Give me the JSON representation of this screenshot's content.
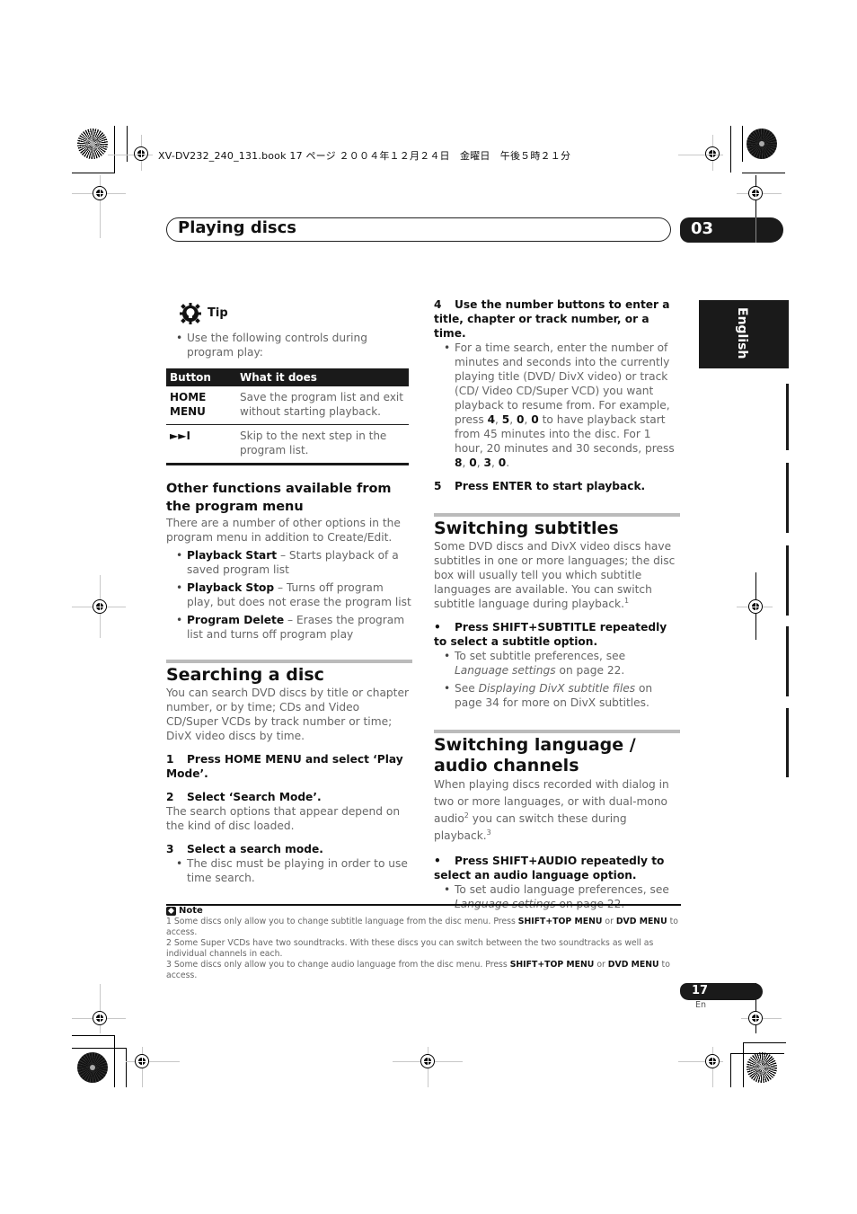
{
  "print_header": "XV-DV232_240_131.book  17 ページ  ２００４年１２月２４日　金曜日　午後５時２１分",
  "chapter": {
    "title": "Playing discs",
    "number": "03"
  },
  "language_tab": "English",
  "tip": {
    "label": "Tip",
    "intro": "Use the following controls during program play:",
    "table": {
      "headers": [
        "Button",
        "What it does"
      ],
      "rows": [
        {
          "button": "HOME MENU",
          "description": "Save the program list and exit without starting playback."
        },
        {
          "button": "►►I",
          "description": "Skip to the next step in the program list."
        }
      ]
    }
  },
  "other_functions": {
    "heading": "Other functions available from the program menu",
    "intro": "There are a number of other options in the program menu in addition to Create/Edit.",
    "items": [
      {
        "term": "Playback Start",
        "text": " – Starts playback of a saved program list"
      },
      {
        "term": "Playback Stop",
        "text": " – Turns off program play, but does not erase the program list"
      },
      {
        "term": "Program Delete",
        "text": " – Erases the program list and turns off program play"
      }
    ]
  },
  "searching": {
    "title": "Searching a disc",
    "intro": "You can search DVD discs by title or chapter number, or by time; CDs and Video CD/Super VCDs by track number or time; DivX video discs by time.",
    "steps": [
      {
        "n": "1",
        "text": "Press HOME MENU and select ‘Play Mode’."
      },
      {
        "n": "2",
        "text": "Select ‘Search Mode’.",
        "body": "The search options that appear depend on the kind of disc loaded."
      },
      {
        "n": "3",
        "text": "Select a search mode.",
        "bullet": "The disc must be playing in order to use time search."
      },
      {
        "n": "4",
        "text": "Use the number buttons to enter a title, chapter or track number, or a time.",
        "bullet_parts": {
          "a": "For a time search, enter the number of minutes and seconds into the currently playing title (DVD/ DivX video) or track (CD/ Video CD/Super VCD) you want playback to resume from. For example, press ",
          "k1": "4",
          "k2": "5",
          "k3": "0",
          "k4": "0",
          "b": " to have playback start from 45 minutes into the disc. For 1 hour, 20 minutes and 30 seconds, press ",
          "k5": "8",
          "k6": "0",
          "k7": "3",
          "k8": "0",
          "c": "."
        }
      },
      {
        "n": "5",
        "text": "Press ENTER to start playback."
      }
    ]
  },
  "subtitles": {
    "title": "Switching subtitles",
    "intro": "Some DVD discs and DivX video discs have subtitles in one or more languages; the disc box will usually tell you which subtitle languages are available. You can switch subtitle language during playback.",
    "intro_ref": "1",
    "step": "Press SHIFT+SUBTITLE repeatedly to select a subtitle option.",
    "bullets": [
      {
        "a": "To set subtitle preferences, see ",
        "ital": "Language settings",
        "b": " on page 22."
      },
      {
        "a": "See ",
        "ital": "Displaying DivX subtitle files",
        "b": " on page 34 for more on DivX subtitles."
      }
    ]
  },
  "audio": {
    "title": "Switching language / audio channels",
    "intro_a": "When playing discs recorded with dialog in two or more languages, or with dual-mono audio",
    "ref_a": "2",
    "intro_b": " you can switch these during playback.",
    "ref_b": "3",
    "step": "Press SHIFT+AUDIO repeatedly to select an audio language option.",
    "bullet": {
      "a": "To set audio language preferences, see ",
      "ital": "Language settings",
      "b": " on page 22."
    }
  },
  "notes": {
    "label": "Note",
    "items": [
      {
        "a": "1 Some discs only allow you to change subtitle language from the disc menu. Press ",
        "k1": "SHIFT+TOP MENU",
        "m": " or ",
        "k2": "DVD MENU",
        "b": " to access."
      },
      {
        "a": "2 Some Super VCDs have two soundtracks. With these discs you can switch between the two soundtracks as well as individual channels in each."
      },
      {
        "a": "3 Some discs only allow you to change audio language from the disc menu. Press ",
        "k1": "SHIFT+TOP MENU",
        "m": " or ",
        "k2": "DVD MENU",
        "b": " to access."
      }
    ]
  },
  "footer": {
    "page_number": "17",
    "page_lang": "En"
  }
}
